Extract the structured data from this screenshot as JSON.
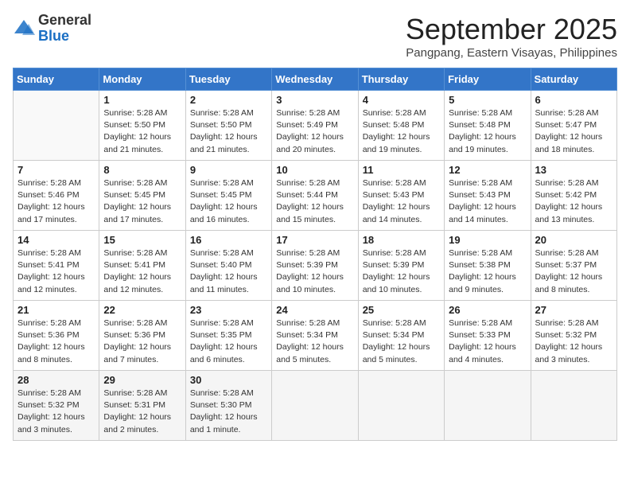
{
  "header": {
    "logo_general": "General",
    "logo_blue": "Blue",
    "month_title": "September 2025",
    "subtitle": "Pangpang, Eastern Visayas, Philippines"
  },
  "weekdays": [
    "Sunday",
    "Monday",
    "Tuesday",
    "Wednesday",
    "Thursday",
    "Friday",
    "Saturday"
  ],
  "weeks": [
    [
      {
        "day": "",
        "info": ""
      },
      {
        "day": "1",
        "info": "Sunrise: 5:28 AM\nSunset: 5:50 PM\nDaylight: 12 hours\nand 21 minutes."
      },
      {
        "day": "2",
        "info": "Sunrise: 5:28 AM\nSunset: 5:50 PM\nDaylight: 12 hours\nand 21 minutes."
      },
      {
        "day": "3",
        "info": "Sunrise: 5:28 AM\nSunset: 5:49 PM\nDaylight: 12 hours\nand 20 minutes."
      },
      {
        "day": "4",
        "info": "Sunrise: 5:28 AM\nSunset: 5:48 PM\nDaylight: 12 hours\nand 19 minutes."
      },
      {
        "day": "5",
        "info": "Sunrise: 5:28 AM\nSunset: 5:48 PM\nDaylight: 12 hours\nand 19 minutes."
      },
      {
        "day": "6",
        "info": "Sunrise: 5:28 AM\nSunset: 5:47 PM\nDaylight: 12 hours\nand 18 minutes."
      }
    ],
    [
      {
        "day": "7",
        "info": "Sunrise: 5:28 AM\nSunset: 5:46 PM\nDaylight: 12 hours\nand 17 minutes."
      },
      {
        "day": "8",
        "info": "Sunrise: 5:28 AM\nSunset: 5:45 PM\nDaylight: 12 hours\nand 17 minutes."
      },
      {
        "day": "9",
        "info": "Sunrise: 5:28 AM\nSunset: 5:45 PM\nDaylight: 12 hours\nand 16 minutes."
      },
      {
        "day": "10",
        "info": "Sunrise: 5:28 AM\nSunset: 5:44 PM\nDaylight: 12 hours\nand 15 minutes."
      },
      {
        "day": "11",
        "info": "Sunrise: 5:28 AM\nSunset: 5:43 PM\nDaylight: 12 hours\nand 14 minutes."
      },
      {
        "day": "12",
        "info": "Sunrise: 5:28 AM\nSunset: 5:43 PM\nDaylight: 12 hours\nand 14 minutes."
      },
      {
        "day": "13",
        "info": "Sunrise: 5:28 AM\nSunset: 5:42 PM\nDaylight: 12 hours\nand 13 minutes."
      }
    ],
    [
      {
        "day": "14",
        "info": "Sunrise: 5:28 AM\nSunset: 5:41 PM\nDaylight: 12 hours\nand 12 minutes."
      },
      {
        "day": "15",
        "info": "Sunrise: 5:28 AM\nSunset: 5:41 PM\nDaylight: 12 hours\nand 12 minutes."
      },
      {
        "day": "16",
        "info": "Sunrise: 5:28 AM\nSunset: 5:40 PM\nDaylight: 12 hours\nand 11 minutes."
      },
      {
        "day": "17",
        "info": "Sunrise: 5:28 AM\nSunset: 5:39 PM\nDaylight: 12 hours\nand 10 minutes."
      },
      {
        "day": "18",
        "info": "Sunrise: 5:28 AM\nSunset: 5:39 PM\nDaylight: 12 hours\nand 10 minutes."
      },
      {
        "day": "19",
        "info": "Sunrise: 5:28 AM\nSunset: 5:38 PM\nDaylight: 12 hours\nand 9 minutes."
      },
      {
        "day": "20",
        "info": "Sunrise: 5:28 AM\nSunset: 5:37 PM\nDaylight: 12 hours\nand 8 minutes."
      }
    ],
    [
      {
        "day": "21",
        "info": "Sunrise: 5:28 AM\nSunset: 5:36 PM\nDaylight: 12 hours\nand 8 minutes."
      },
      {
        "day": "22",
        "info": "Sunrise: 5:28 AM\nSunset: 5:36 PM\nDaylight: 12 hours\nand 7 minutes."
      },
      {
        "day": "23",
        "info": "Sunrise: 5:28 AM\nSunset: 5:35 PM\nDaylight: 12 hours\nand 6 minutes."
      },
      {
        "day": "24",
        "info": "Sunrise: 5:28 AM\nSunset: 5:34 PM\nDaylight: 12 hours\nand 5 minutes."
      },
      {
        "day": "25",
        "info": "Sunrise: 5:28 AM\nSunset: 5:34 PM\nDaylight: 12 hours\nand 5 minutes."
      },
      {
        "day": "26",
        "info": "Sunrise: 5:28 AM\nSunset: 5:33 PM\nDaylight: 12 hours\nand 4 minutes."
      },
      {
        "day": "27",
        "info": "Sunrise: 5:28 AM\nSunset: 5:32 PM\nDaylight: 12 hours\nand 3 minutes."
      }
    ],
    [
      {
        "day": "28",
        "info": "Sunrise: 5:28 AM\nSunset: 5:32 PM\nDaylight: 12 hours\nand 3 minutes."
      },
      {
        "day": "29",
        "info": "Sunrise: 5:28 AM\nSunset: 5:31 PM\nDaylight: 12 hours\nand 2 minutes."
      },
      {
        "day": "30",
        "info": "Sunrise: 5:28 AM\nSunset: 5:30 PM\nDaylight: 12 hours\nand 1 minute."
      },
      {
        "day": "",
        "info": ""
      },
      {
        "day": "",
        "info": ""
      },
      {
        "day": "",
        "info": ""
      },
      {
        "day": "",
        "info": ""
      }
    ]
  ]
}
